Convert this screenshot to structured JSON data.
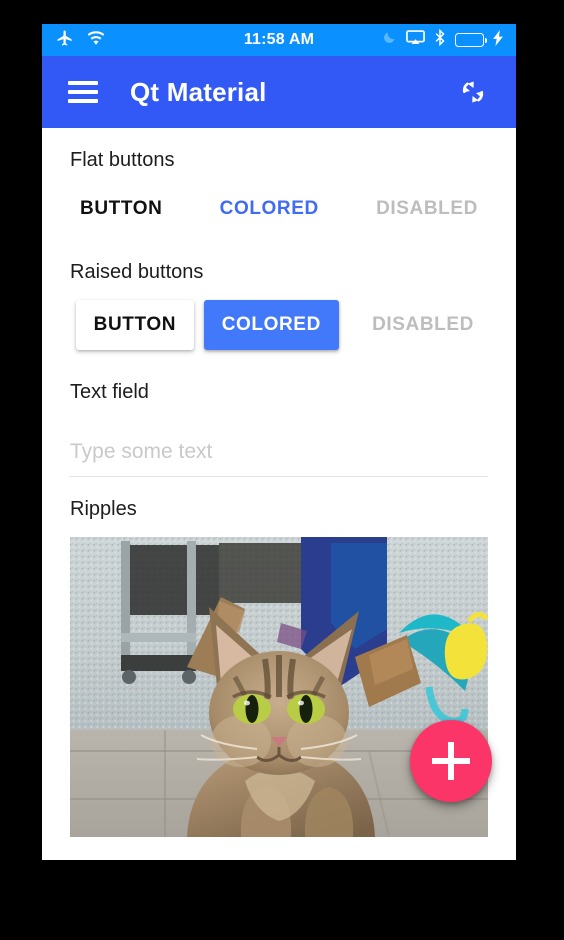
{
  "status_bar": {
    "airplane_icon": "airplane-mode-icon",
    "wifi_icon": "wifi-icon",
    "time": "11:58 AM",
    "do_not_disturb_icon": "moon-icon",
    "airplay_icon": "airplay-icon",
    "bluetooth_icon": "bluetooth-icon",
    "battery_icon": "battery-icon",
    "charging_icon": "charging-bolt-icon",
    "background_color": "#0a90ff",
    "battery_fill_color": "#23f033"
  },
  "app_bar": {
    "menu_icon": "hamburger-menu-icon",
    "title": "Qt Material",
    "refresh_icon": "sync-refresh-icon",
    "background_color": "#3259f5"
  },
  "sections": {
    "flat_buttons": {
      "label": "Flat buttons",
      "buttons": [
        {
          "label": "BUTTON",
          "state": "default",
          "color": "#111111"
        },
        {
          "label": "COLORED",
          "state": "colored",
          "color": "#3f6bf5"
        },
        {
          "label": "DISABLED",
          "state": "disabled",
          "color": "#bdbdbd"
        }
      ]
    },
    "raised_buttons": {
      "label": "Raised buttons",
      "buttons": [
        {
          "label": "BUTTON",
          "state": "default",
          "color": "#111111"
        },
        {
          "label": "COLORED",
          "state": "colored",
          "color": "#ffffff",
          "background": "#4278fa"
        },
        {
          "label": "DISABLED",
          "state": "disabled",
          "color": "#bdbdbd"
        }
      ]
    },
    "text_field": {
      "label": "Text field",
      "value": "",
      "placeholder": "Type some text"
    },
    "ripples": {
      "label": "Ripples",
      "image_alt": "tabby-cat-photo"
    }
  },
  "fab": {
    "icon": "plus-icon",
    "color": "#fc3568"
  }
}
